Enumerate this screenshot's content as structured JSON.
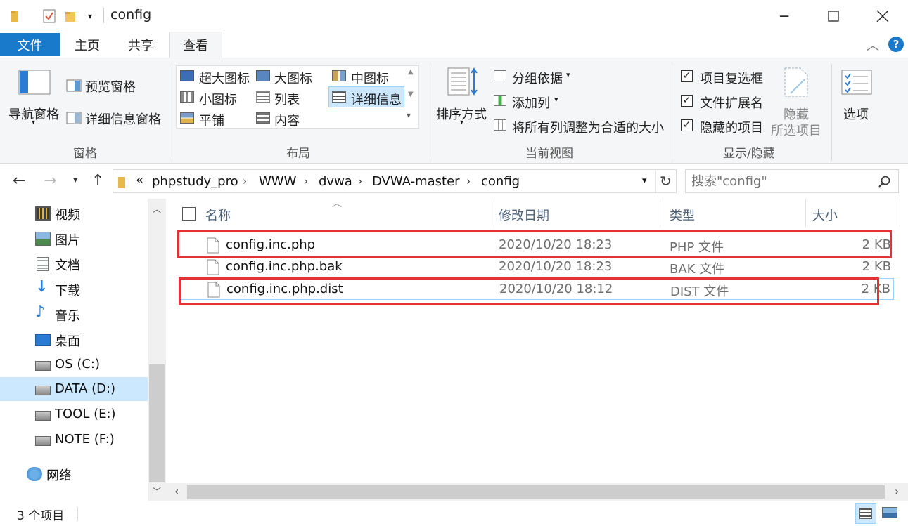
{
  "window": {
    "title": "config",
    "minimize_icon": "minimize-icon",
    "maximize_icon": "maximize-icon",
    "close_icon": "close-icon"
  },
  "ribbon_tabs": [
    "文件",
    "主页",
    "共享",
    "查看"
  ],
  "active_tab": "查看",
  "ribbon": {
    "panes": {
      "name": "窗格",
      "nav_pane": "导航窗格",
      "preview_pane": "预览窗格",
      "details_pane": "详细信息窗格"
    },
    "layout": {
      "name": "布局",
      "items": [
        "超大图标",
        "大图标",
        "中图标",
        "小图标",
        "列表",
        "详细信息",
        "平铺",
        "内容"
      ],
      "selected": "详细信息"
    },
    "current_view": {
      "name": "当前视图",
      "sort_by": "排序方式",
      "group_by": "分组依据",
      "add_columns": "添加列",
      "size_all_columns": "将所有列调整为合适的大小"
    },
    "show_hide": {
      "name": "显示/隐藏",
      "item_checkboxes": "项目复选框",
      "file_extensions": "文件扩展名",
      "hidden_items": "隐藏的项目",
      "hide_selected_line1": "隐藏",
      "hide_selected_line2": "所选项目",
      "options": "选项",
      "checked": [
        true,
        true,
        true
      ]
    }
  },
  "address": {
    "overflow": "«",
    "breadcrumbs": [
      "phpstudy_pro",
      "WWW",
      "dvwa",
      "DVWA-master",
      "config"
    ],
    "search_placeholder": "搜索\"config\""
  },
  "nav_pane": {
    "items": [
      {
        "label": "视频",
        "icon": "video-folder-icon"
      },
      {
        "label": "图片",
        "icon": "pictures-folder-icon"
      },
      {
        "label": "文档",
        "icon": "documents-folder-icon"
      },
      {
        "label": "下载",
        "icon": "download-arrow-icon"
      },
      {
        "label": "音乐",
        "icon": "music-note-icon"
      },
      {
        "label": "桌面",
        "icon": "desktop-icon"
      },
      {
        "label": "OS (C:)",
        "icon": "drive-icon"
      },
      {
        "label": "DATA (D:)",
        "icon": "drive-icon"
      },
      {
        "label": "TOOL (E:)",
        "icon": "drive-icon"
      },
      {
        "label": "NOTE (F:)",
        "icon": "drive-icon"
      },
      {
        "label": "网络",
        "icon": "network-icon"
      }
    ],
    "selected": "DATA (D:)"
  },
  "file_list": {
    "columns": [
      "名称",
      "修改日期",
      "类型",
      "大小"
    ],
    "rows": [
      {
        "name": "config.inc.php",
        "date": "2020/10/20 18:23",
        "type": "PHP 文件",
        "size": "2 KB"
      },
      {
        "name": "config.inc.php.bak",
        "date": "2020/10/20 18:23",
        "type": "BAK 文件",
        "size": "2 KB"
      },
      {
        "name": "config.inc.php.dist",
        "date": "2020/10/20 18:12",
        "type": "DIST 文件",
        "size": "2 KB"
      }
    ]
  },
  "status": {
    "item_count": "3 个项目"
  },
  "colors": {
    "file_tab": "#1979ca",
    "highlight_box": "#e53238",
    "header_text": "#4c607a",
    "selected_nav": "#cce8ff"
  }
}
